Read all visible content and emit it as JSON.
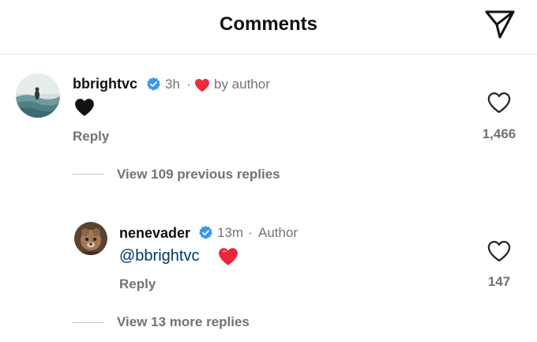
{
  "header": {
    "title": "Comments"
  },
  "comments": [
    {
      "username": "bbrightvc",
      "time": "3h",
      "sep": "·",
      "liked_by_author": "by author",
      "reply_label": "Reply",
      "like_count": "1,466"
    }
  ],
  "thread": {
    "view_previous": "View 109 previous replies",
    "view_more": "View 13 more replies"
  },
  "replies": [
    {
      "username": "nenevader",
      "time": "13m",
      "sep": "·",
      "role": "Author",
      "mention": "@bbrightvc",
      "reply_label": "Reply",
      "like_count": "147"
    }
  ],
  "colors": {
    "verified": "#3897f0",
    "heart_red": "#ed2b3c",
    "mention": "#00376b",
    "muted": "#737373"
  },
  "icons": [
    "share-icon",
    "verified-icon",
    "heart-icon",
    "black-heart-emoji",
    "red-heart-emoji"
  ]
}
